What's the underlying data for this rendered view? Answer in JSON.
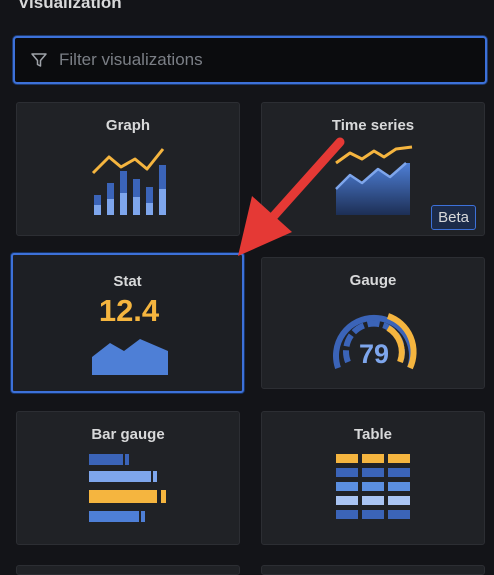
{
  "header": {
    "title": "Visualization"
  },
  "filter": {
    "placeholder": "Filter visualizations",
    "icon": "filter-icon"
  },
  "cards": [
    {
      "label": "Graph",
      "icon": "graph-icon"
    },
    {
      "label": "Time series",
      "icon": "time-series-icon",
      "badge": "Beta"
    },
    {
      "label": "Stat",
      "icon": "stat-icon",
      "value": "12.4",
      "selected": true
    },
    {
      "label": "Gauge",
      "icon": "gauge-icon",
      "value": "79"
    },
    {
      "label": "Bar gauge",
      "icon": "bar-gauge-icon"
    },
    {
      "label": "Table",
      "icon": "table-icon"
    }
  ],
  "colors": {
    "accent": "#3d71d9",
    "blue": "#5b8fe0",
    "orange": "#f5b53f",
    "red_arrow": "#e53935"
  }
}
